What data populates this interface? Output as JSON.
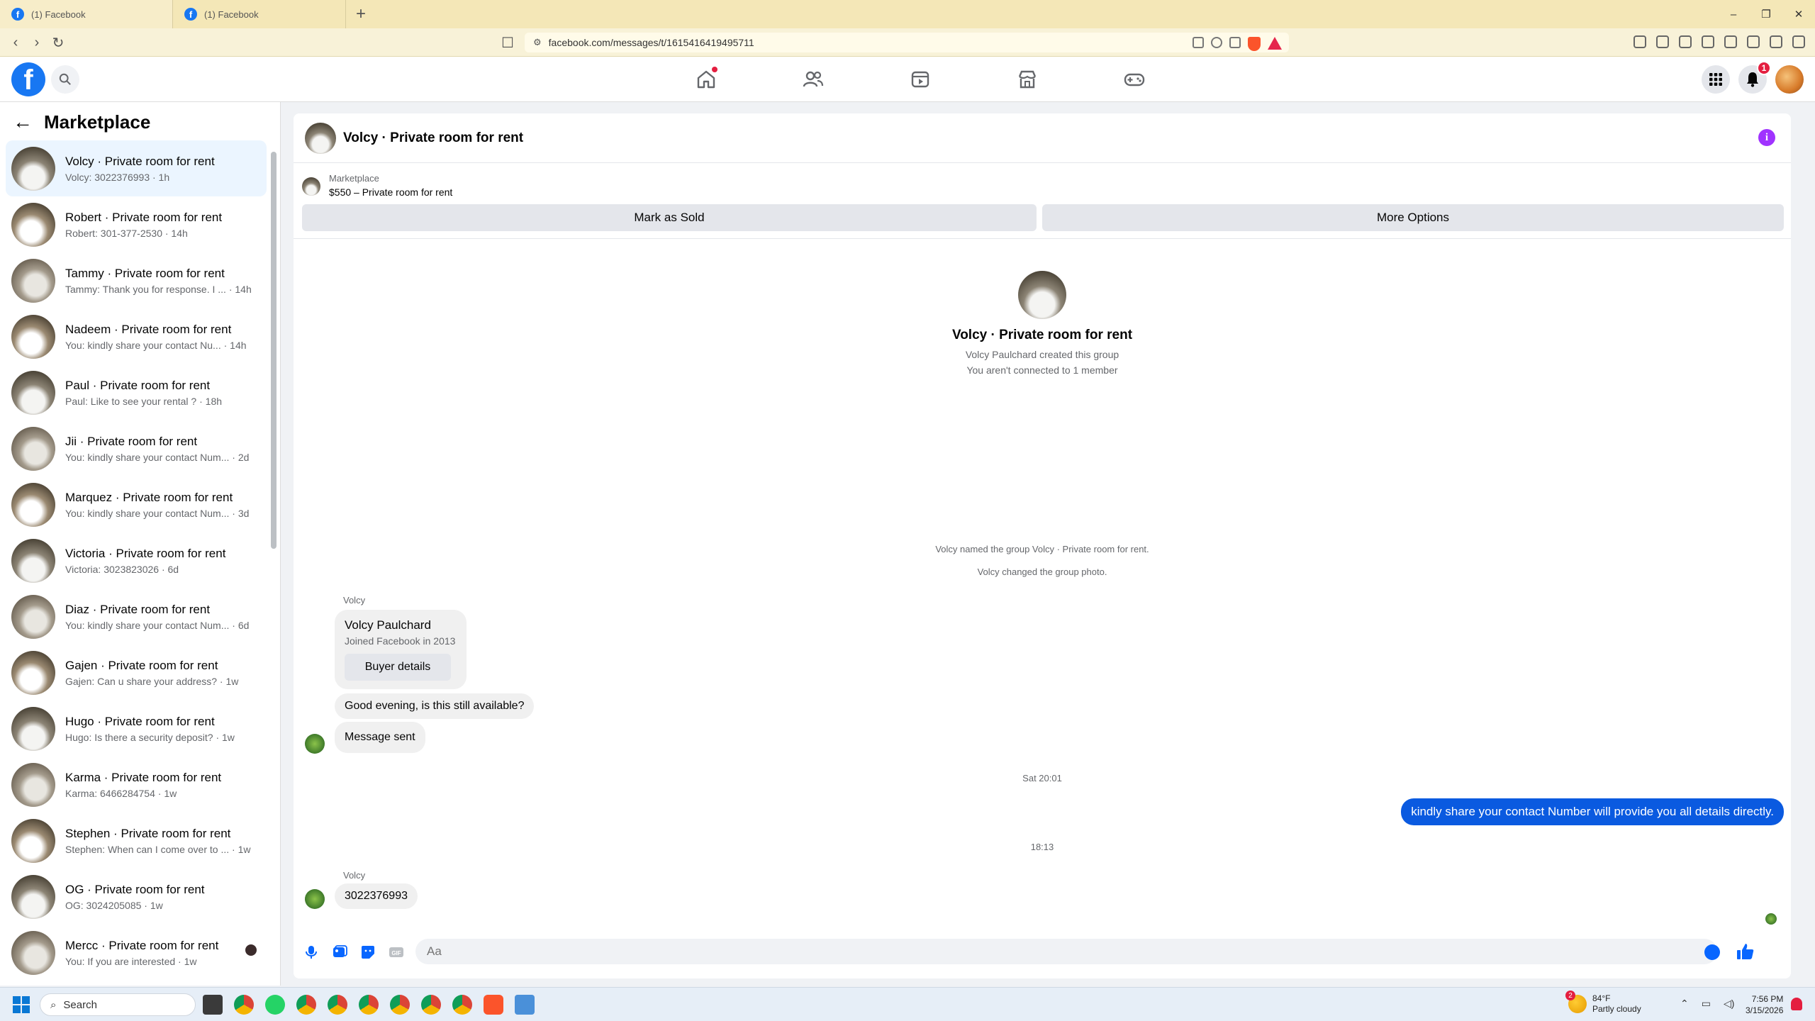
{
  "browser": {
    "tabs": [
      {
        "title": "(1) Facebook"
      },
      {
        "title": "(1) Facebook"
      }
    ],
    "new_tab": "+",
    "url": "facebook.com/messages/t/1615416419495711",
    "window_controls": [
      "–",
      "❐",
      "✕"
    ]
  },
  "fb": {
    "logo": "f",
    "notification_count": "1"
  },
  "sidebar": {
    "title": "Marketplace",
    "conversations": [
      {
        "title": "Volcy · Private room for rent",
        "subtitle": "Volcy: 3022376993 · 1h"
      },
      {
        "title": "Robert · Private room for rent",
        "subtitle": "Robert: 301-377-2530 · 14h"
      },
      {
        "title": "Tammy · Private room for rent",
        "subtitle": "Tammy: Thank you for response. I ... · 14h"
      },
      {
        "title": "Nadeem · Private room for rent",
        "subtitle": "You: kindly share your contact Nu... · 14h"
      },
      {
        "title": "Paul · Private room for rent",
        "subtitle": "Paul: Like to see your rental ? · 18h"
      },
      {
        "title": "Jii · Private room for rent",
        "subtitle": "You: kindly share your contact Num... · 2d"
      },
      {
        "title": "Marquez · Private room for rent",
        "subtitle": "You: kindly share your contact Num... · 3d"
      },
      {
        "title": "Victoria · Private room for rent",
        "subtitle": "Victoria: 3023823026 · 6d"
      },
      {
        "title": "Diaz · Private room for rent",
        "subtitle": "You: kindly share your contact Num... · 6d"
      },
      {
        "title": "Gajen · Private room for rent",
        "subtitle": "Gajen: Can u share your address? · 1w"
      },
      {
        "title": "Hugo · Private room for rent",
        "subtitle": "Hugo: Is there a security deposit? · 1w"
      },
      {
        "title": "Karma · Private room for rent",
        "subtitle": "Karma: 6466284754 · 1w"
      },
      {
        "title": "Stephen · Private room for rent",
        "subtitle": "Stephen: When can I come over to ... · 1w"
      },
      {
        "title": "OG · Private room for rent",
        "subtitle": "OG: 3024205085 · 1w"
      },
      {
        "title": "Mercc · Private room for rent",
        "subtitle": "You: If you are interested · 1w"
      }
    ]
  },
  "chat": {
    "title": "Volcy · Private room for rent",
    "marketplace_label": "Marketplace",
    "listing": "$550 – Private room for rent",
    "mark_sold": "Mark as Sold",
    "more_options": "More Options",
    "group_name": "Volcy · Private room for rent",
    "created_by": "Volcy Paulchard created this group",
    "connection": "You aren't connected to 1 member",
    "sys_named": "Volcy named the group Volcy · Private room for rent.",
    "sys_photo": "Volcy changed the group photo.",
    "sender1": "Volcy",
    "card_name": "Volcy Paulchard",
    "card_joined": "Joined Facebook in 2013",
    "buyer_details": "Buyer details",
    "msg_available": "Good evening, is this still available?",
    "msg_sent": "Message sent",
    "time1": "Sat 20:01",
    "outgoing": "kindly share your contact Number will provide you all details directly.",
    "time2": "18:13",
    "sender2": "Volcy",
    "msg_number": "3022376993",
    "input_placeholder": "Aa"
  },
  "taskbar": {
    "search": "Search",
    "weather_temp": "84°F",
    "weather_desc": "Partly cloudy",
    "weather_badge": "2",
    "time": "7:56 PM",
    "date": "3/15/2026"
  }
}
